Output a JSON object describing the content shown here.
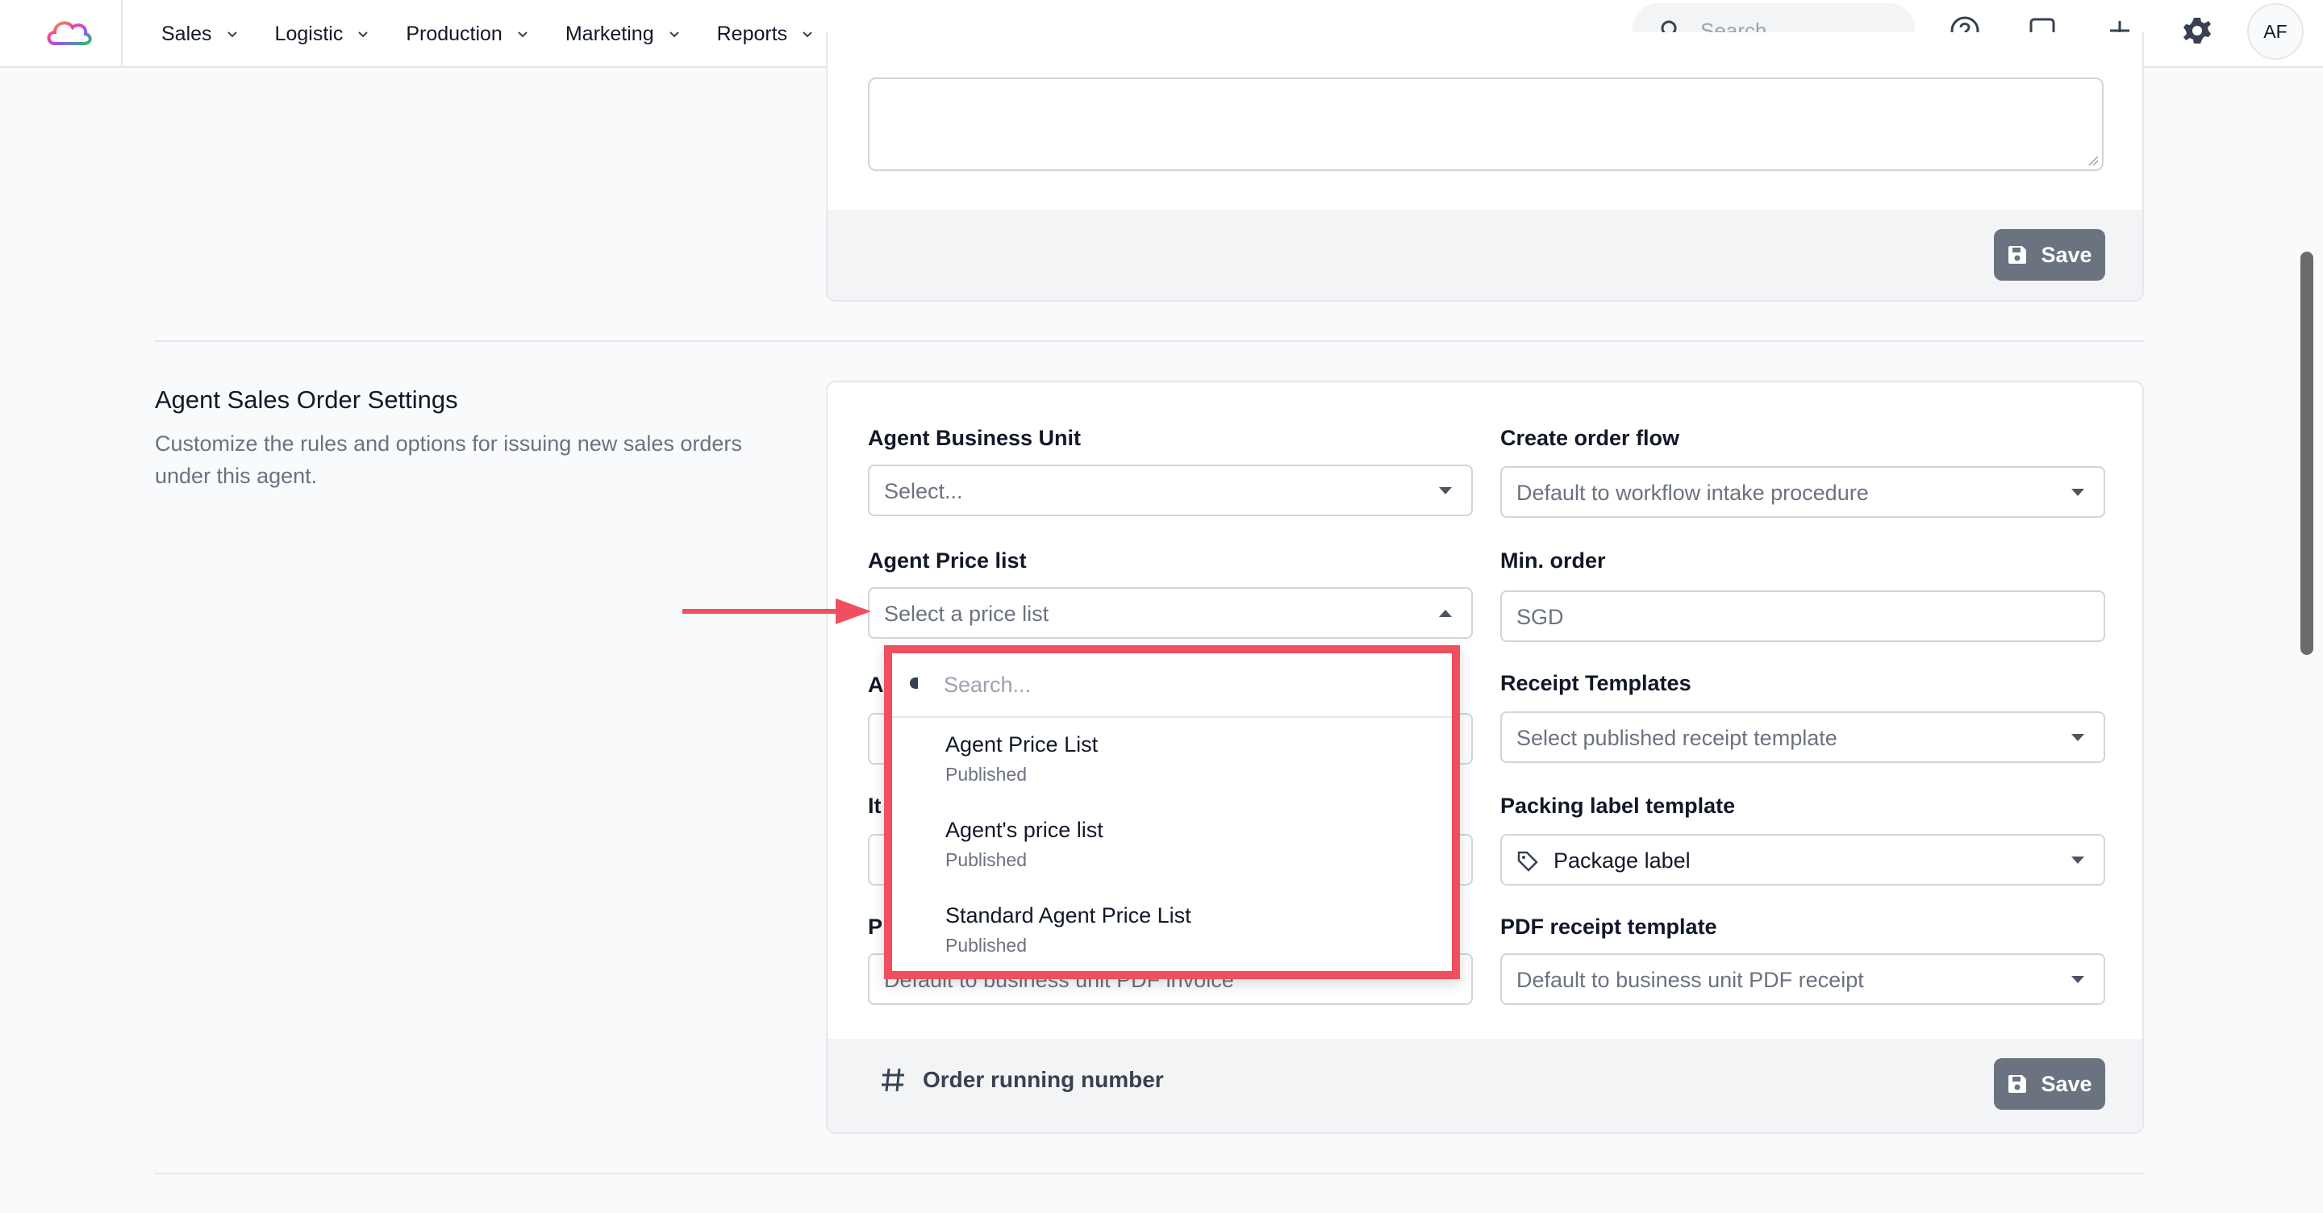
{
  "nav": {
    "items": [
      {
        "label": "Sales"
      },
      {
        "label": "Logistic"
      },
      {
        "label": "Production"
      },
      {
        "label": "Marketing"
      },
      {
        "label": "Reports"
      }
    ],
    "search_placeholder": "Search",
    "avatar_initials": "AF"
  },
  "upper_card": {
    "save_label": "Save"
  },
  "section": {
    "title": "Agent Sales Order Settings",
    "description": "Customize the rules and options for issuing new sales orders under this agent."
  },
  "fields": {
    "agent_business_unit": {
      "label": "Agent Business Unit",
      "placeholder": "Select..."
    },
    "create_order_flow": {
      "label": "Create order flow",
      "value": "Default to workflow intake procedure"
    },
    "agent_price_list": {
      "label": "Agent Price list",
      "placeholder": "Select a price list"
    },
    "min_order": {
      "label": "Min. order",
      "value": "SGD"
    },
    "receipt_templates": {
      "label": "Receipt Templates",
      "placeholder": "Select published receipt template"
    },
    "packing_label_template": {
      "label": "Packing label template",
      "value": "Package label"
    },
    "pdf_receipt_template": {
      "label": "PDF receipt template",
      "value": "Default to business unit PDF receipt"
    },
    "pdf_invoice_hidden": {
      "value": "Default to business unit PDF invoice"
    },
    "hidden_label_a": "A",
    "hidden_label_it": "It",
    "hidden_label_p": "P"
  },
  "dropdown": {
    "search_placeholder": "Search...",
    "options": [
      {
        "name": "Agent Price List",
        "status": "Published"
      },
      {
        "name": "Agent's price list",
        "status": "Published"
      },
      {
        "name": "Standard Agent Price List",
        "status": "Published"
      }
    ]
  },
  "footer": {
    "order_running_number": "Order running number",
    "save_label": "Save"
  },
  "colors": {
    "highlight": "#ef4f5e",
    "save_button": "#6b7280"
  }
}
